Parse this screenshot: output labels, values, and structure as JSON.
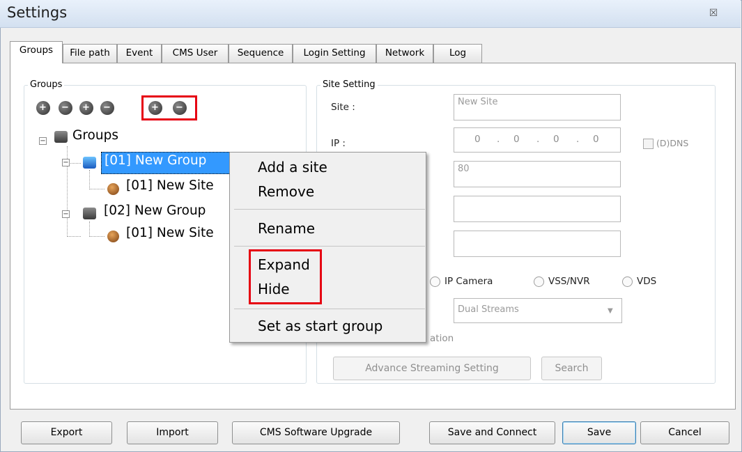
{
  "window": {
    "title": "Settings",
    "close_glyph": "☒"
  },
  "tabs": [
    "Groups",
    "File path",
    "Event",
    "CMS User",
    "Sequence",
    "Login Setting",
    "Network",
    "Log"
  ],
  "groups_panel": {
    "legend": "Groups",
    "toolbar_icons": [
      "add-group-icon",
      "remove-group-icon",
      "add-site-icon",
      "remove-site-icon",
      "expand-all-icon",
      "collapse-all-icon"
    ],
    "tree": {
      "root": "Groups",
      "groups": [
        {
          "label": "[01] New Group",
          "sites": [
            "[01] New Site"
          ]
        },
        {
          "label": "[02] New Group",
          "sites": [
            "[01] New Site"
          ]
        }
      ]
    }
  },
  "site_setting": {
    "legend": "Site Setting",
    "site_label": "Site :",
    "site_value": "New Site",
    "ip_label": "IP :",
    "ip_octets": [
      "0",
      "0",
      "0",
      "0"
    ],
    "ddns_label": "(D)DNS",
    "port_value": "80",
    "radio_options": [
      "IP Camera",
      "VSS/NVR",
      "VDS"
    ],
    "stream_select": "Dual Streams",
    "checkbox_label_partial": "ation",
    "advance_button": "Advance Streaming Setting",
    "search_button": "Search"
  },
  "context_menu": {
    "items": [
      "Add a site",
      "Remove",
      "Rename",
      "Expand",
      "Hide",
      "Set as start group"
    ]
  },
  "footer": {
    "export": "Export",
    "import": "Import",
    "upgrade": "CMS Software Upgrade",
    "save_connect": "Save and Connect",
    "save": "Save",
    "cancel": "Cancel"
  },
  "colors": {
    "highlight": "#e60012",
    "selection": "#3399ff"
  }
}
